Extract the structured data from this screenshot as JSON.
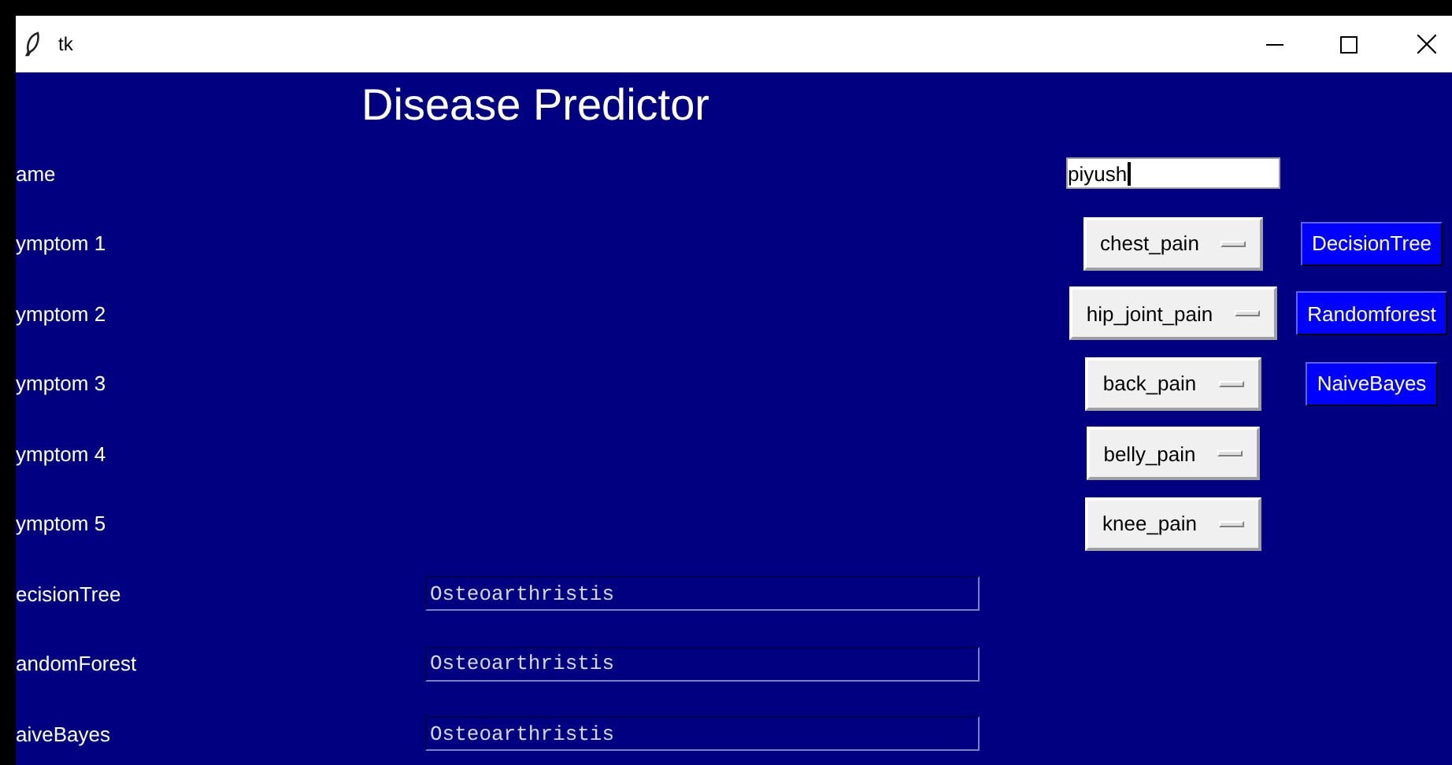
{
  "window": {
    "title": "tk"
  },
  "heading": "Disease Predictor",
  "name_field": {
    "label": "ame",
    "value": "piyush"
  },
  "symptoms": [
    {
      "label": "ymptom 1",
      "value": "chest_pain"
    },
    {
      "label": "ymptom 2",
      "value": "hip_joint_pain"
    },
    {
      "label": "ymptom 3",
      "value": "back_pain"
    },
    {
      "label": "ymptom 4",
      "value": "belly_pain"
    },
    {
      "label": "ymptom 5",
      "value": "knee_pain"
    }
  ],
  "buttons": [
    "DecisionTree",
    "Randomforest",
    "NaiveBayes"
  ],
  "results": [
    {
      "label": "ecisionTree",
      "value": "Osteoarthristis"
    },
    {
      "label": "andomForest",
      "value": "Osteoarthristis"
    },
    {
      "label": "aiveBayes",
      "value": "Osteoarthristis"
    }
  ]
}
